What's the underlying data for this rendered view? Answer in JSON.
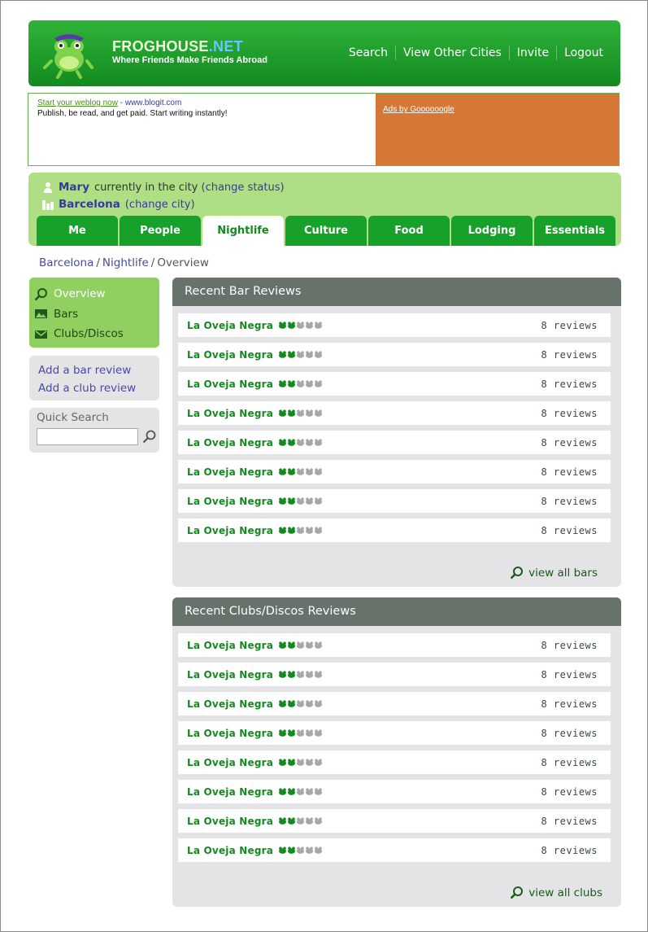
{
  "header": {
    "brand_name": "FROGHOUSE",
    "brand_suffix": ".NET",
    "tagline": "Where Friends Make Friends Abroad",
    "nav": [
      "Search",
      "View Other Cities",
      "Invite",
      "Logout"
    ]
  },
  "ad": {
    "link_text": "Start your weblog now",
    "url_text": "- www.blogit.com",
    "description": "Publish, be read, and get paid. Start writing instantly!",
    "ads_by": "Ads by Goooooogle"
  },
  "status": {
    "user": "Mary",
    "currently": "currently in the city",
    "change_status": "(change status)",
    "city": "Barcelona",
    "change_city": "(change city)"
  },
  "tabs": [
    "Me",
    "People",
    "Nightlife",
    "Culture",
    "Food",
    "Lodging",
    "Essentials"
  ],
  "active_tab": "Nightlife",
  "breadcrumb": {
    "city": "Barcelona",
    "section": "Nightlife",
    "page": "Overview",
    "sep": "/"
  },
  "sidenav": {
    "items": [
      {
        "label": "Overview",
        "icon": "magnifier-icon",
        "active": true
      },
      {
        "label": "Bars",
        "icon": "picture-icon",
        "active": false
      },
      {
        "label": "Clubs/Discos",
        "icon": "envelope-icon",
        "active": false
      }
    ]
  },
  "add_links": [
    "Add a bar review",
    "Add a club review"
  ],
  "quick_search": {
    "label": "Quick Search",
    "value": ""
  },
  "bar_reviews": {
    "title": "Recent Bar Reviews",
    "rows": [
      {
        "name": "La Oveja Negra",
        "rating": 2,
        "max": 5,
        "reviews": "8 reviews"
      },
      {
        "name": "La Oveja Negra",
        "rating": 2,
        "max": 5,
        "reviews": "8 reviews"
      },
      {
        "name": "La Oveja Negra",
        "rating": 2,
        "max": 5,
        "reviews": "8 reviews"
      },
      {
        "name": "La Oveja Negra",
        "rating": 2,
        "max": 5,
        "reviews": "8 reviews"
      },
      {
        "name": "La Oveja Negra",
        "rating": 2,
        "max": 5,
        "reviews": "8 reviews"
      },
      {
        "name": "La Oveja Negra",
        "rating": 2,
        "max": 5,
        "reviews": "8 reviews"
      },
      {
        "name": "La Oveja Negra",
        "rating": 2,
        "max": 5,
        "reviews": "8 reviews"
      },
      {
        "name": "La Oveja Negra",
        "rating": 2,
        "max": 5,
        "reviews": "8 reviews"
      }
    ],
    "view_all": "view all bars"
  },
  "club_reviews": {
    "title": "Recent Clubs/Discos Reviews",
    "rows": [
      {
        "name": "La Oveja Negra",
        "rating": 2,
        "max": 5,
        "reviews": "8 reviews"
      },
      {
        "name": "La Oveja Negra",
        "rating": 2,
        "max": 5,
        "reviews": "8 reviews"
      },
      {
        "name": "La Oveja Negra",
        "rating": 2,
        "max": 5,
        "reviews": "8 reviews"
      },
      {
        "name": "La Oveja Negra",
        "rating": 2,
        "max": 5,
        "reviews": "8 reviews"
      },
      {
        "name": "La Oveja Negra",
        "rating": 2,
        "max": 5,
        "reviews": "8 reviews"
      },
      {
        "name": "La Oveja Negra",
        "rating": 2,
        "max": 5,
        "reviews": "8 reviews"
      },
      {
        "name": "La Oveja Negra",
        "rating": 2,
        "max": 5,
        "reviews": "8 reviews"
      },
      {
        "name": "La Oveja Negra",
        "rating": 2,
        "max": 5,
        "reviews": "8 reviews"
      }
    ],
    "view_all": "view all clubs"
  },
  "colors": {
    "brand_green": "#17a02a",
    "panel_header": "#66726a",
    "ad_orange": "#d77735",
    "status_bg": "#aedf85"
  }
}
